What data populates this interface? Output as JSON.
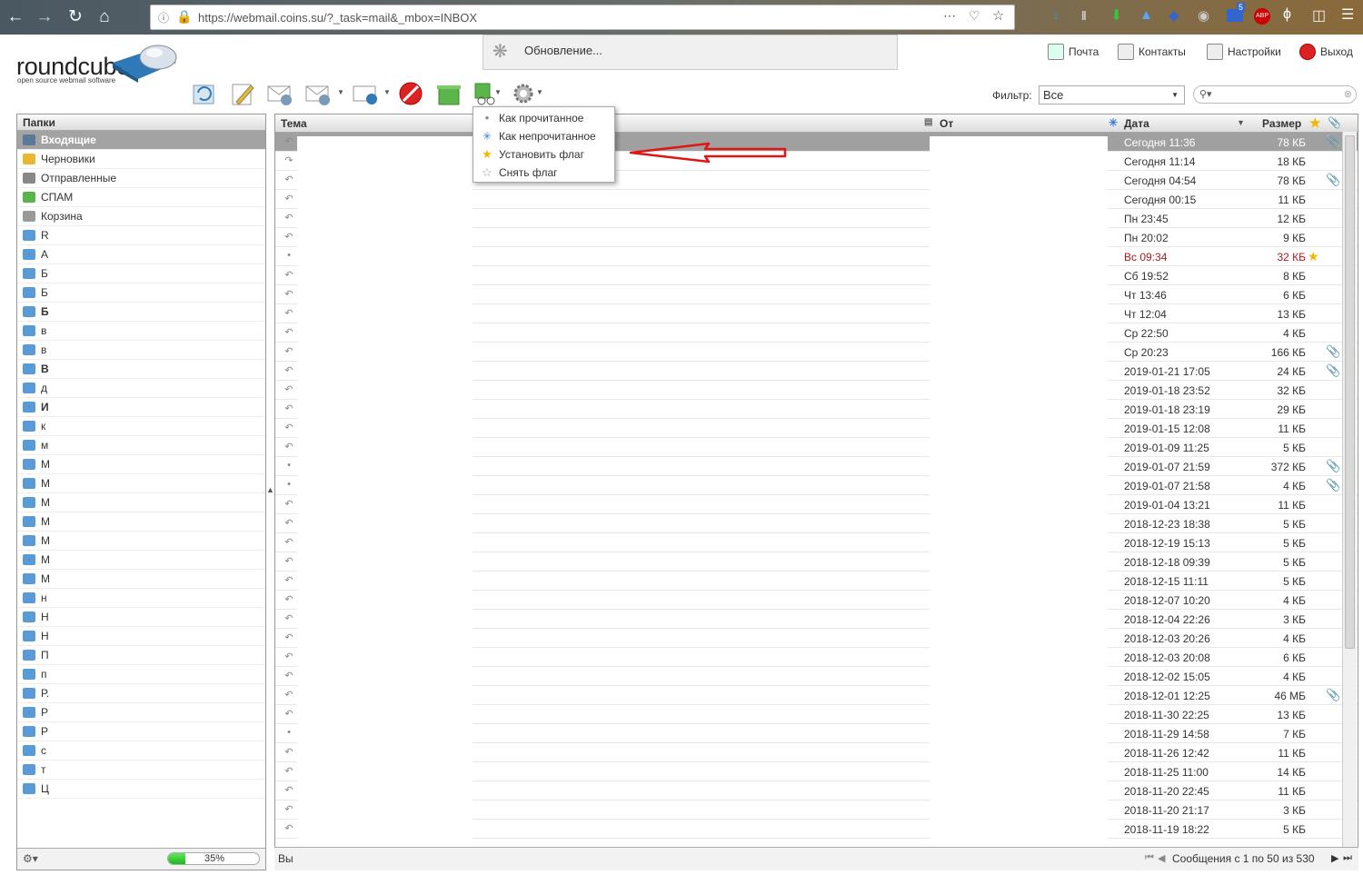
{
  "browser": {
    "url": "https://webmail.coins.su/?_task=mail&_mbox=INBOX",
    "badge_count": "5"
  },
  "app": {
    "logo_text": "roundcube",
    "logo_subtitle": "open source webmail software"
  },
  "loading": {
    "text": "Обновление..."
  },
  "topnav": {
    "mail": "Почта",
    "contacts": "Контакты",
    "settings": "Настройки",
    "logout": "Выход"
  },
  "filter": {
    "label": "Фильтр:",
    "value": "Все"
  },
  "search": {
    "placeholder": ""
  },
  "folders": {
    "header": "Папки",
    "items": [
      {
        "label": "Входящие",
        "icon": "inbox-icon"
      },
      {
        "label": "Черновики",
        "icon": "pencil-icon"
      },
      {
        "label": "Отправленные",
        "icon": "sent-icon"
      },
      {
        "label": "СПАМ",
        "icon": "spam-icon"
      },
      {
        "label": "Корзина",
        "icon": "trash-icon"
      },
      {
        "label": "R"
      },
      {
        "label": "А"
      },
      {
        "label": "Б"
      },
      {
        "label": "Б"
      },
      {
        "label": "Б"
      },
      {
        "label": "в"
      },
      {
        "label": "в"
      },
      {
        "label": "В"
      },
      {
        "label": "д"
      },
      {
        "label": "И"
      },
      {
        "label": "к"
      },
      {
        "label": "м"
      },
      {
        "label": "М"
      },
      {
        "label": "М"
      },
      {
        "label": "М"
      },
      {
        "label": "М"
      },
      {
        "label": "М"
      },
      {
        "label": "М"
      },
      {
        "label": "М"
      },
      {
        "label": "н"
      },
      {
        "label": "Н"
      },
      {
        "label": "Н"
      },
      {
        "label": "П"
      },
      {
        "label": "п"
      },
      {
        "label": "Р."
      },
      {
        "label": "Р"
      },
      {
        "label": "Р"
      },
      {
        "label": "с"
      },
      {
        "label": "т"
      },
      {
        "label": "Ц"
      }
    ],
    "quota_text": "35%",
    "quota_fraction": 0.35
  },
  "menu": {
    "items": [
      {
        "label": "Как прочитанное",
        "icon": "dot-icon"
      },
      {
        "label": "Как непрочитанное",
        "icon": "star-burst-icon"
      },
      {
        "label": "Установить флаг",
        "icon": "star-icon"
      },
      {
        "label": "Снять флаг",
        "icon": "star-outline-icon"
      }
    ]
  },
  "messages": {
    "col_subject": "Тема",
    "col_from": "От",
    "col_date": "Дата",
    "col_size": "Размер",
    "rows": [
      {
        "date": "Сегодня 11:36",
        "size": "78 КБ",
        "status": "reply",
        "attach": true,
        "selected": true
      },
      {
        "date": "Сегодня 11:14",
        "size": "18 КБ",
        "status": "forward"
      },
      {
        "date": "Сегодня 04:54",
        "size": "78 КБ",
        "status": "reply",
        "attach": true
      },
      {
        "date": "Сегодня 00:15",
        "size": "11 КБ",
        "status": "reply"
      },
      {
        "date": "Пн 23:45",
        "size": "12 КБ",
        "status": "reply"
      },
      {
        "date": "Пн 20:02",
        "size": "9 КБ",
        "status": "reply"
      },
      {
        "date": "Вс 09:34",
        "size": "32 КБ",
        "status": "dot",
        "flag": true
      },
      {
        "date": "Сб 19:52",
        "size": "8 КБ",
        "status": "reply"
      },
      {
        "date": "Чт 13:46",
        "size": "6 КБ",
        "status": "reply"
      },
      {
        "date": "Чт 12:04",
        "size": "13 КБ",
        "status": "reply"
      },
      {
        "date": "Ср 22:50",
        "size": "4 КБ",
        "status": "reply"
      },
      {
        "date": "Ср 20:23",
        "size": "166 КБ",
        "status": "reply",
        "attach": true
      },
      {
        "date": "2019-01-21 17:05",
        "size": "24 КБ",
        "status": "reply",
        "attach": true
      },
      {
        "date": "2019-01-18 23:52",
        "size": "32 КБ",
        "status": "reply"
      },
      {
        "date": "2019-01-18 23:19",
        "size": "29 КБ",
        "status": "reply"
      },
      {
        "date": "2019-01-15 12:08",
        "size": "11 КБ",
        "status": "reply"
      },
      {
        "date": "2019-01-09 11:25",
        "size": "5 КБ",
        "status": "reply"
      },
      {
        "date": "2019-01-07 21:59",
        "size": "372 КБ",
        "status": "dot",
        "attach": true
      },
      {
        "date": "2019-01-07 21:58",
        "size": "4 КБ",
        "status": "dot",
        "attach": true
      },
      {
        "date": "2019-01-04 13:21",
        "size": "11 КБ",
        "status": "reply"
      },
      {
        "date": "2018-12-23 18:38",
        "size": "5 КБ",
        "status": "reply"
      },
      {
        "date": "2018-12-19 15:13",
        "size": "5 КБ",
        "status": "reply"
      },
      {
        "date": "2018-12-18 09:39",
        "size": "5 КБ",
        "status": "reply"
      },
      {
        "date": "2018-12-15 11:11",
        "size": "5 КБ",
        "status": "reply"
      },
      {
        "date": "2018-12-07 10:20",
        "size": "4 КБ",
        "status": "reply"
      },
      {
        "date": "2018-12-04 22:26",
        "size": "3 КБ",
        "status": "reply"
      },
      {
        "date": "2018-12-03 20:26",
        "size": "4 КБ",
        "status": "reply"
      },
      {
        "date": "2018-12-03 20:08",
        "size": "6 КБ",
        "status": "reply"
      },
      {
        "date": "2018-12-02 15:05",
        "size": "4 КБ",
        "status": "reply"
      },
      {
        "date": "2018-12-01 12:25",
        "size": "46 МБ",
        "status": "reply",
        "attach": true
      },
      {
        "date": "2018-11-30 22:25",
        "size": "13 КБ",
        "status": "reply"
      },
      {
        "date": "2018-11-29 14:58",
        "size": "7 КБ",
        "status": "dot"
      },
      {
        "date": "2018-11-26 12:42",
        "size": "11 КБ",
        "status": "reply"
      },
      {
        "date": "2018-11-25 11:00",
        "size": "14 КБ",
        "status": "reply"
      },
      {
        "date": "2018-11-20 22:45",
        "size": "11 КБ",
        "status": "reply"
      },
      {
        "date": "2018-11-20 21:17",
        "size": "3 КБ",
        "status": "reply"
      },
      {
        "date": "2018-11-19 18:22",
        "size": "5 КБ",
        "status": "reply"
      }
    ],
    "footer_text": "Сообщения с 1 по 50 из 530",
    "footer_left": "Вы"
  }
}
